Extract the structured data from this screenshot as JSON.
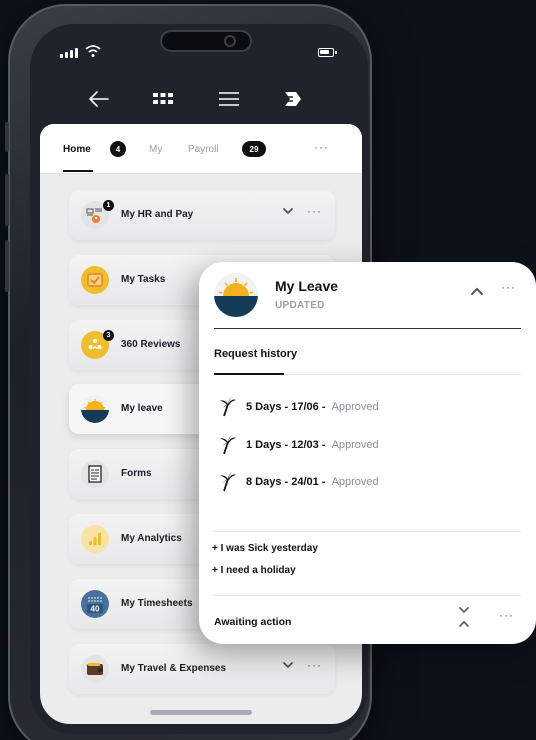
{
  "tabs": {
    "home_label": "Home",
    "home_badge": "4",
    "my_label": "My",
    "payroll_label": "Payroll",
    "payroll_badge": "29",
    "more_label": "···"
  },
  "menu": {
    "items": [
      {
        "label": "My HR and Pay",
        "badge": "1",
        "icon": "hr-pay-icon"
      },
      {
        "label": "My Tasks",
        "icon": "tasks-icon"
      },
      {
        "label": "360 Reviews",
        "badge": "3",
        "icon": "reviews-icon"
      },
      {
        "label": "My leave",
        "icon": "leave-icon"
      },
      {
        "label": "Forms",
        "icon": "forms-icon"
      },
      {
        "label": "My Analytics",
        "icon": "analytics-icon"
      },
      {
        "label": "My Timesheets",
        "icon": "timesheets-icon",
        "icon_text": "40"
      },
      {
        "label": "My Travel & Expenses",
        "icon": "wallet-icon"
      }
    ],
    "more_label": "···"
  },
  "card": {
    "title": "My Leave",
    "subtitle": "UPDATED",
    "more_label": "···",
    "section_label": "Request history",
    "requests": [
      {
        "text": "5 Days - 17/06 - ",
        "status": "Approved"
      },
      {
        "text": "1 Days - 12/03 - ",
        "status": "Approved"
      },
      {
        "text": "8 Days - 24/01 - ",
        "status": "Approved"
      }
    ],
    "actions": [
      "+ I was Sick yesterday",
      "+ I need a holiday"
    ],
    "footer_label": "Awaiting action",
    "footer_more": "···"
  },
  "colors": {
    "background": "#0d121a",
    "leave_navy": "#143b57",
    "leave_sun": "#f3b31c",
    "accent_orange": "#ee7d33",
    "tasks_yellow": "#f0bd2e",
    "timesheet_blue": "#47709a"
  }
}
